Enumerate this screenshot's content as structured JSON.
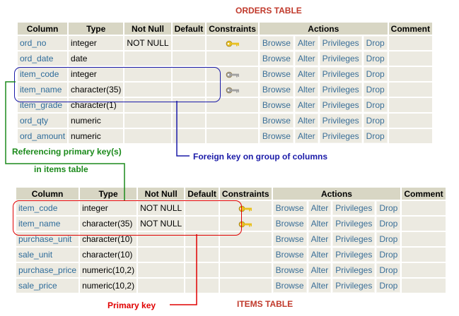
{
  "orders_title": "ORDERS TABLE",
  "items_title": "ITEMS TABLE",
  "headers": [
    "Column",
    "Type",
    "Not Null",
    "Default",
    "Constraints",
    "Actions",
    "Comment"
  ],
  "actions": [
    "Browse",
    "Alter",
    "Privileges",
    "Drop"
  ],
  "orders_rows": [
    {
      "column": "ord_no",
      "type": "integer",
      "not_null": "NOT NULL",
      "key": "gold"
    },
    {
      "column": "ord_date",
      "type": "date",
      "not_null": "",
      "key": ""
    },
    {
      "column": "item_code",
      "type": "integer",
      "not_null": "",
      "key": "gray"
    },
    {
      "column": "item_name",
      "type": "character(35)",
      "not_null": "",
      "key": "gray"
    },
    {
      "column": "item_grade",
      "type": "character(1)",
      "not_null": "",
      "key": ""
    },
    {
      "column": "ord_qty",
      "type": "numeric",
      "not_null": "",
      "key": ""
    },
    {
      "column": "ord_amount",
      "type": "numeric",
      "not_null": "",
      "key": ""
    }
  ],
  "items_rows": [
    {
      "column": "item_code",
      "type": "integer",
      "not_null": "NOT NULL",
      "key": "gold"
    },
    {
      "column": "item_name",
      "type": "character(35)",
      "not_null": "NOT NULL",
      "key": "gold"
    },
    {
      "column": "purchase_unit",
      "type": "character(10)",
      "not_null": "",
      "key": ""
    },
    {
      "column": "sale_unit",
      "type": "character(10)",
      "not_null": "",
      "key": ""
    },
    {
      "column": "purchase_price",
      "type": "numeric(10,2)",
      "not_null": "",
      "key": ""
    },
    {
      "column": "sale_price",
      "type": "numeric(10,2)",
      "not_null": "",
      "key": ""
    }
  ],
  "annotations": {
    "ref_line1": "Referencing primary key(s)",
    "ref_line2": "in items table",
    "foreign_key": "Foreign key on group of columns",
    "primary_key": "Primary key"
  },
  "colors": {
    "gold_key": "#e8c020",
    "gray_key": "#a0a0a0",
    "link": "#2d6b9a",
    "header_bg": "#d8d6c4",
    "row_bg": "#eceae1"
  }
}
